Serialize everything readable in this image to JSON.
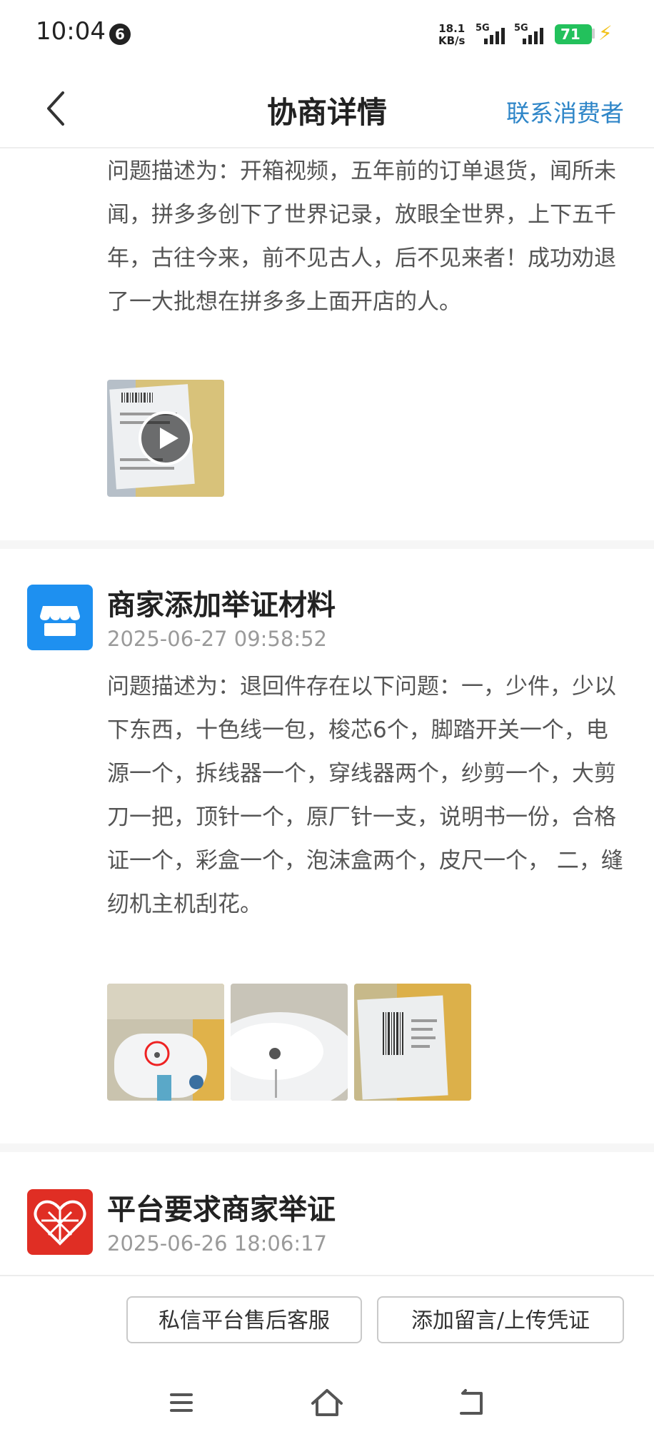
{
  "status_bar": {
    "time": "10:04",
    "notif_count": "6",
    "net_speed_value": "18.1",
    "net_speed_unit": "KB/s",
    "sim1": "5G",
    "sim2": "5G",
    "battery": "71"
  },
  "nav": {
    "title": "协商详情",
    "action": "联系消费者"
  },
  "entry_top": {
    "description": "问题描述为：开箱视频，五年前的订单退货，闻所未闻，拼多多创下了世界记录，放眼全世界，上下五千年，古往今来，前不见古人，后不见来者！成功劝退了一大批想在拼多多上面开店的人。"
  },
  "entry_merchant": {
    "title": "商家添加举证材料",
    "time": "2025-06-27 09:58:52",
    "description": "问题描述为：退回件存在以下问题：一，少件，少以下东西，十色线一包，梭芯6个，脚踏开关一个，电源一个，拆线器一个，穿线器两个，纱剪一个，大剪刀一把，顶针一个，原厂针一支，说明书一份，合格证一个，彩盒一个，泡沫盒两个，皮尺一个， 二，缝纫机主机刮花。"
  },
  "entry_platform": {
    "title": "平台要求商家举证",
    "time": "2025-06-26 18:06:17"
  },
  "footer": {
    "btn_service": "私信平台售后客服",
    "btn_upload": "添加留言/上传凭证"
  },
  "colors": {
    "accent": "#2f86c8",
    "merchant_icon": "#1e90f0",
    "platform_icon": "#e02e24",
    "battery": "#23c15c"
  }
}
